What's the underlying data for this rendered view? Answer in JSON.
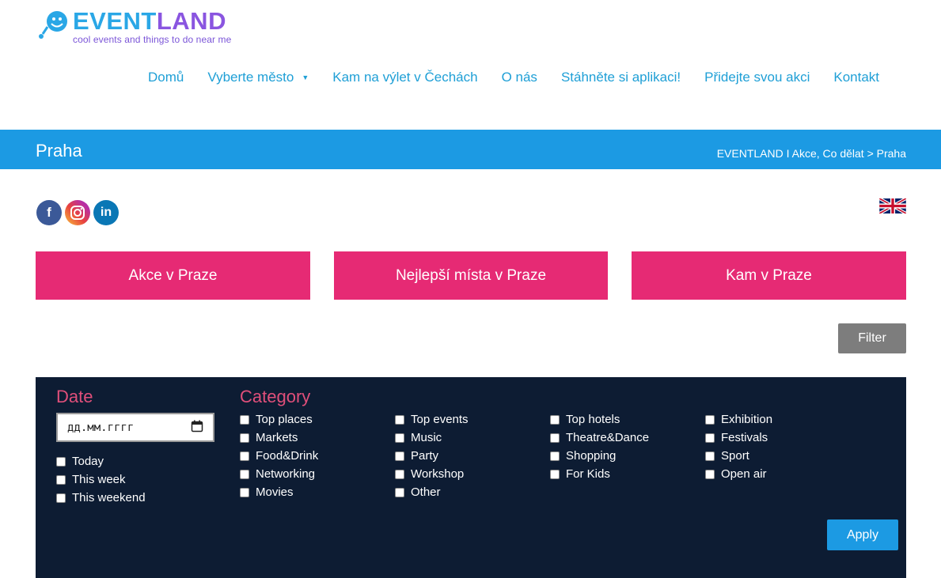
{
  "logo": {
    "name_part1": "EVENT",
    "name_part2": "LAND",
    "tagline": "cool events and things to do near me"
  },
  "nav": {
    "items": [
      {
        "label": "Domů"
      },
      {
        "label": "Vyberte město",
        "dropdown": true
      },
      {
        "label": "Kam na výlet v Čechách"
      },
      {
        "label": "O nás"
      },
      {
        "label": "Stáhněte si aplikaci!"
      },
      {
        "label": "Přidejte svou akci"
      },
      {
        "label": "Kontakt"
      }
    ]
  },
  "titlebar": {
    "title": "Praha",
    "breadcrumb": "EVENTLAND I Akce, Co dělat > Praha"
  },
  "socials": [
    "facebook-icon",
    "instagram-icon",
    "linkedin-icon"
  ],
  "cta": [
    "Akce v Praze",
    "Nejlepší místa v Praze",
    "Kam v Praze"
  ],
  "filter_button": "Filter",
  "filter": {
    "date_heading": "Date",
    "date_placeholder": "дд.мм.гггг",
    "date_options": [
      "Today",
      "This week",
      "This weekend"
    ],
    "category_heading": "Category",
    "categories": [
      [
        "Top places",
        "Markets",
        "Food&Drink",
        "Networking",
        "Movies"
      ],
      [
        "Top events",
        "Music",
        "Party",
        "Workshop",
        "Other"
      ],
      [
        "Top hotels",
        "Theatre&Dance",
        "Shopping",
        "For Kids"
      ],
      [
        "Exhibition",
        "Festivals",
        "Sport",
        "Open air"
      ]
    ],
    "apply_label": "Apply"
  },
  "colors": {
    "accent_blue": "#1c9ae3",
    "pink": "#e62a74",
    "panel_bg": "#0d1c33",
    "heading_pink": "#e04f7a"
  }
}
